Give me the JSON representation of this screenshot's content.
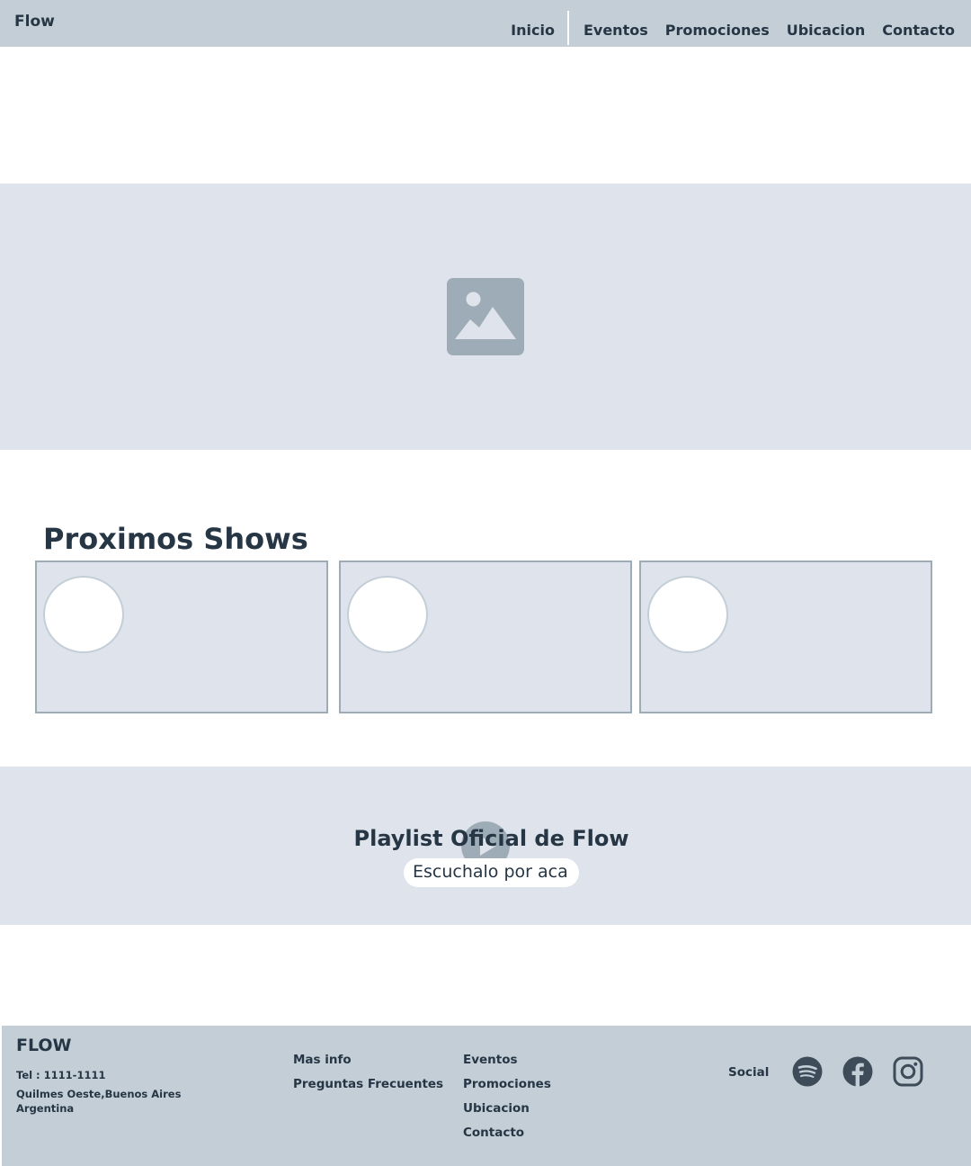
{
  "header": {
    "brand": "Flow",
    "nav": [
      "Inicio",
      "Eventos",
      "Promociones",
      "Ubicacion",
      "Contacto"
    ]
  },
  "hero": {
    "icon": "image-placeholder-icon"
  },
  "shows": {
    "title": "Proximos Shows",
    "cards": [
      {},
      {},
      {}
    ]
  },
  "playlist": {
    "title": "Playlist Oficial de Flow",
    "button": "Escuchalo por aca",
    "icon": "play-icon"
  },
  "footer": {
    "brand": "FLOW",
    "phone": "Tel : 1111-1111",
    "address_line1": "Quilmes Oeste,Buenos Aires",
    "address_line2": "Argentina",
    "info_links": [
      "Mas info",
      "Preguntas Frecuentes"
    ],
    "nav_links": [
      "Eventos",
      "Promociones",
      "Ubicacion",
      "Contacto"
    ],
    "social_label": "Social",
    "social_icons": [
      "spotify-icon",
      "facebook-icon",
      "instagram-icon"
    ]
  },
  "colors": {
    "header_bg": "#c3ced7",
    "section_bg": "#dfe4ec",
    "text": "#263645",
    "icon": "#9eacb8"
  }
}
